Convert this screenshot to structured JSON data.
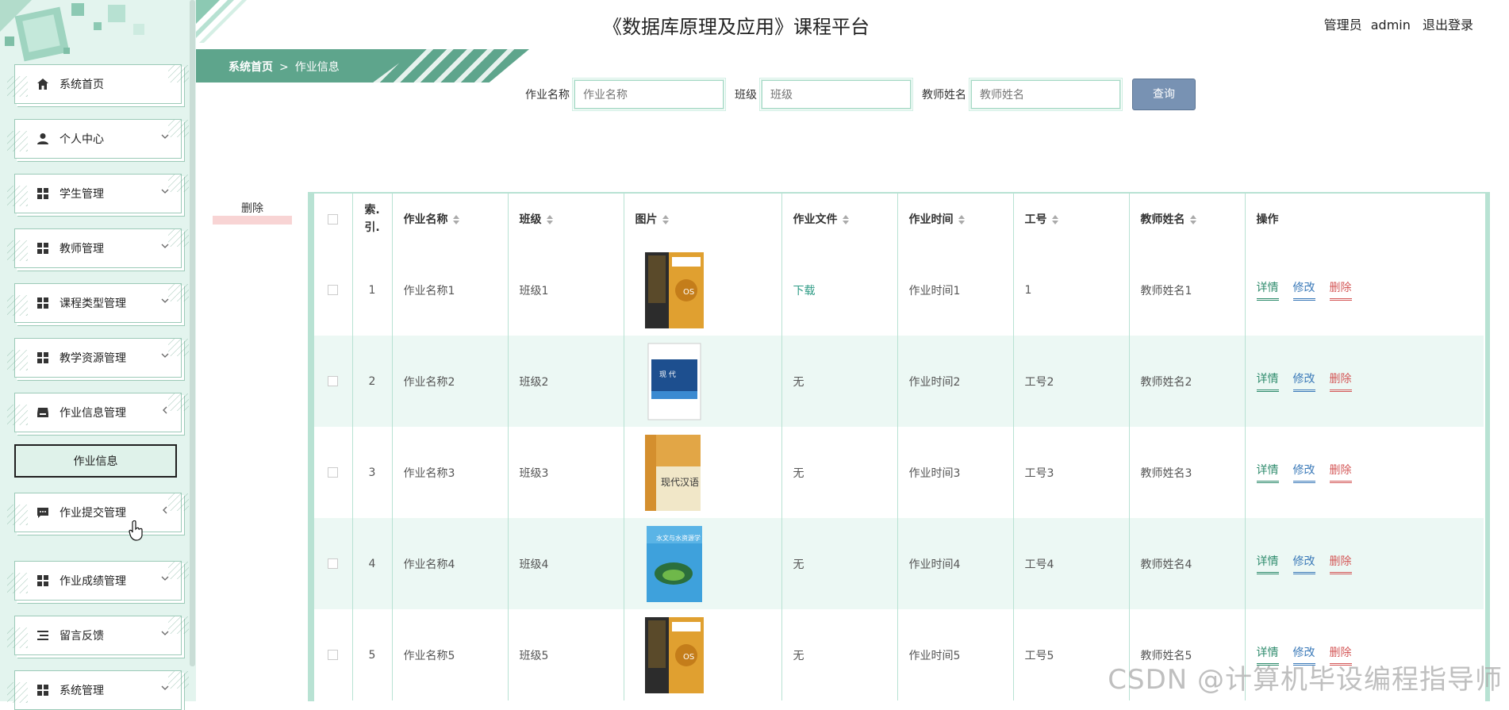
{
  "app_title": "《数据库原理及应用》课程平台",
  "user": {
    "role": "管理员",
    "name": "admin",
    "logout": "退出登录"
  },
  "breadcrumb": {
    "home": "系统首页",
    "separator": ">",
    "current": "作业信息"
  },
  "sidebar": {
    "items": [
      {
        "label": "系统首页",
        "icon": "home-icon"
      },
      {
        "label": "个人中心",
        "icon": "user-icon"
      },
      {
        "label": "学生管理",
        "icon": "grid-icon"
      },
      {
        "label": "教师管理",
        "icon": "grid-icon"
      },
      {
        "label": "课程类型管理",
        "icon": "grid-icon"
      },
      {
        "label": "教学资源管理",
        "icon": "grid-icon"
      },
      {
        "label": "作业信息管理",
        "icon": "tray-icon"
      },
      {
        "label": "作业提交管理",
        "icon": "chat-icon"
      },
      {
        "label": "作业成绩管理",
        "icon": "grid-icon"
      },
      {
        "label": "留言反馈",
        "icon": "list-icon"
      },
      {
        "label": "系统管理",
        "icon": "grid-icon"
      }
    ],
    "active_sub": "作业信息"
  },
  "search": {
    "f1": {
      "label": "作业名称",
      "placeholder": "作业名称"
    },
    "f2": {
      "label": "班级",
      "placeholder": "班级"
    },
    "f3": {
      "label": "教师姓名",
      "placeholder": "教师姓名"
    },
    "button": "查询"
  },
  "delete_button": "删除",
  "table": {
    "columns": [
      "索引",
      "作业名称",
      "班级",
      "图片",
      "作业文件",
      "作业时间",
      "工号",
      "教师姓名",
      "操作"
    ],
    "index_col": {
      "line1": "索.",
      "line2": "引."
    },
    "actions": {
      "detail": "详情",
      "edit": "修改",
      "delete": "删除"
    },
    "rows": [
      {
        "index": "1",
        "name": "作业名称1",
        "class": "班级1",
        "cover": "book-cover-dark-gold",
        "file": "下载",
        "time": "作业时间1",
        "id": "1",
        "teacher": "教师姓名1"
      },
      {
        "index": "2",
        "name": "作业名称2",
        "class": "班级2",
        "cover": "book-cover-blue",
        "file": "无",
        "time": "作业时间2",
        "id": "工号2",
        "teacher": "教师姓名2"
      },
      {
        "index": "3",
        "name": "作业名称3",
        "class": "班级3",
        "cover": "book-cover-beige",
        "file": "无",
        "time": "作业时间3",
        "id": "工号3",
        "teacher": "教师姓名3"
      },
      {
        "index": "4",
        "name": "作业名称4",
        "class": "班级4",
        "cover": "book-cover-sky",
        "file": "无",
        "time": "作业时间4",
        "id": "工号4",
        "teacher": "教师姓名4"
      },
      {
        "index": "5",
        "name": "作业名称5",
        "class": "班级5",
        "cover": "book-cover-dark-gold",
        "file": "无",
        "time": "作业时间5",
        "id": "工号5",
        "teacher": "教师姓名5"
      }
    ]
  },
  "watermark": "CSDN @计算机毕设编程指导师",
  "colors": {
    "accent": "#5ea58c",
    "sidebar_bg": "#e3f4ee",
    "row_stripe": "#ecf8f4",
    "search_button": "#7892b3",
    "border": "#b8e2d3"
  }
}
